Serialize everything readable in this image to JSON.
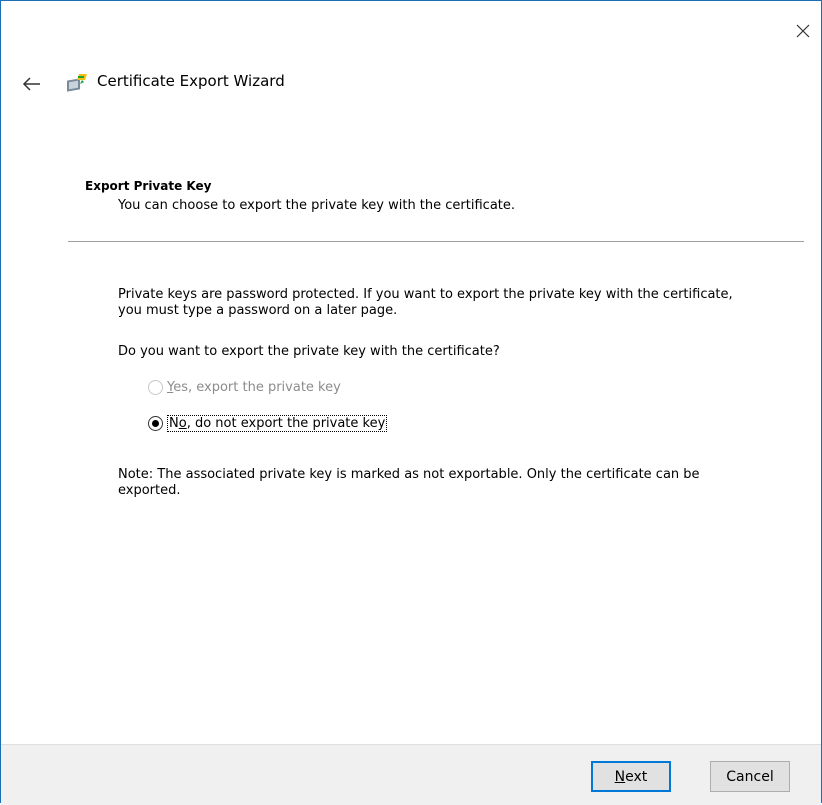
{
  "window": {
    "title": "Certificate Export Wizard"
  },
  "page": {
    "section_title": "Export Private Key",
    "section_subtitle": "You can choose to export the private key with the certificate.",
    "intro": "Private keys are password protected. If you want to export the private key with the certificate, you must type a password on a later page.",
    "question": "Do you want to export the private key with the certificate?",
    "options": [
      {
        "mnemonic": "Y",
        "rest": "es, export the private key",
        "selected": false,
        "enabled": false
      },
      {
        "prefix": "N",
        "mnemonic": "o",
        "rest": ", do not export the private key",
        "selected": true,
        "enabled": true
      }
    ],
    "note": "Note: The associated private key is marked as not exportable. Only the certificate can be exported."
  },
  "footer": {
    "next": {
      "mnemonic": "N",
      "rest": "ext"
    },
    "cancel_label": "Cancel"
  },
  "icons": {
    "close": "close-icon",
    "back": "back-arrow-icon",
    "wizard": "certificate-wizard-icon"
  },
  "colors": {
    "accent": "#0078d7",
    "disabled_text": "#8c8c8c",
    "footer_bg": "#f0f0f0"
  }
}
